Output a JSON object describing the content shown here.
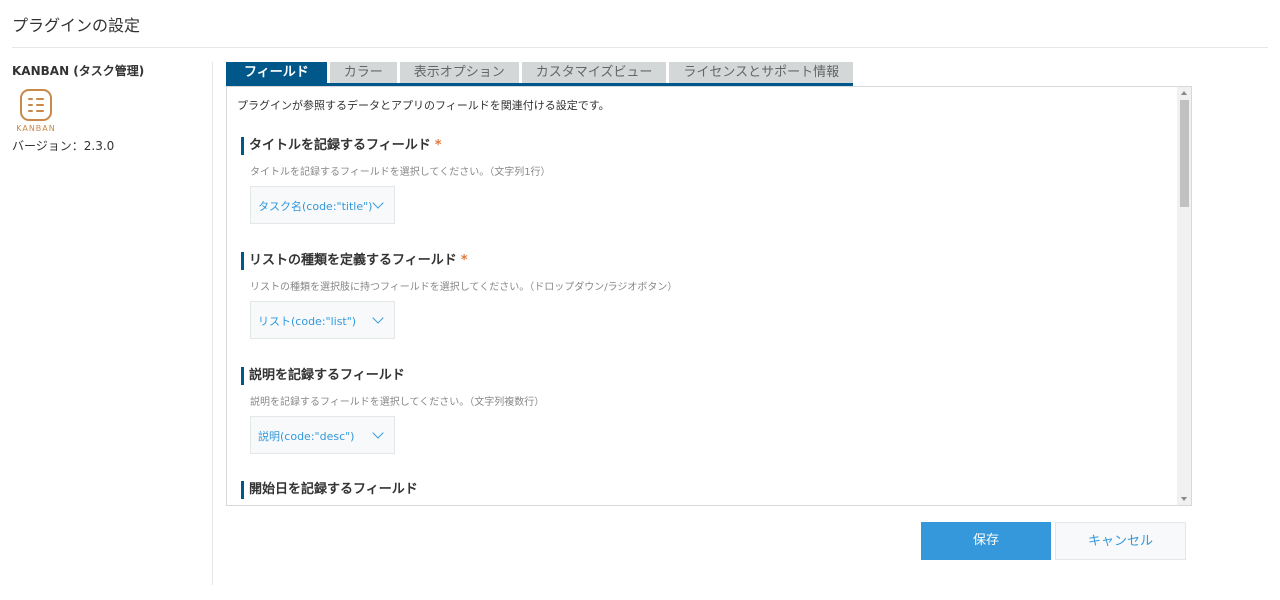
{
  "page": {
    "title": "プラグインの設定"
  },
  "plugin": {
    "name": "KANBAN (タスク管理)",
    "logo_text": "KANBAN",
    "version": "バージョン：2.3.0",
    "logo_color": "#c8884a"
  },
  "tabs": [
    {
      "label": "フィールド"
    },
    {
      "label": "カラー"
    },
    {
      "label": "表示オプション"
    },
    {
      "label": "カスタマイズビュー"
    },
    {
      "label": "ライセンスとサポート情報"
    }
  ],
  "content": {
    "intro": "プラグインが参照するデータとアプリのフィールドを関連付ける設定です。",
    "sections": [
      {
        "title": "タイトルを記録するフィールド",
        "required_mark": "*",
        "desc": "タイトルを記録するフィールドを選択してください。（文字列1行）",
        "selected": "タスク名(code:\"title\")"
      },
      {
        "title": "リストの種類を定義するフィールド",
        "required_mark": "*",
        "desc": "リストの種類を選択肢に持つフィールドを選択してください。（ドロップダウン/ラジオボタン）",
        "selected": "リスト(code:\"list\")"
      },
      {
        "title": "説明を記録するフィールド",
        "desc": "説明を記録するフィールドを選択してください。（文字列複数行）",
        "selected": "説明(code:\"desc\")"
      },
      {
        "title": "開始日を記録するフィールド"
      }
    ]
  },
  "buttons": {
    "save": "保存",
    "cancel": "キャンセル"
  },
  "colors": {
    "accent": "#00588a",
    "primary_button": "#3498db",
    "required": "#e07a3c"
  }
}
